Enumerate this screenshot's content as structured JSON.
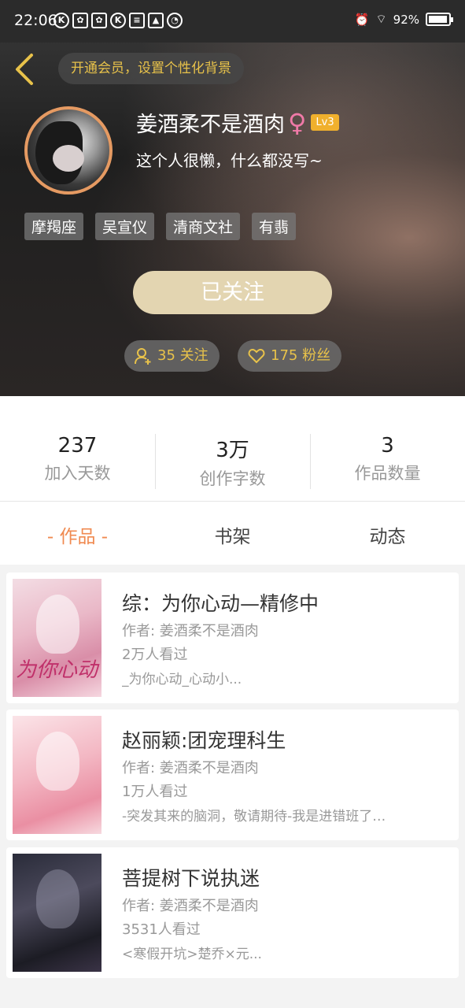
{
  "status": {
    "time": "22:06",
    "battery": "92%"
  },
  "header": {
    "vip_banner": "开通会员，设置个性化背景",
    "username": "姜酒柔不是酒肉",
    "gender": "♀",
    "level": "Lv3",
    "bio": "这个人很懒，什么都没写~",
    "tags": [
      "摩羯座",
      "吴宣仪",
      "清商文社",
      "有翡"
    ],
    "follow_label": "已关注",
    "following_text": "35 关注",
    "fans_text": "175 粉丝"
  },
  "stats": [
    {
      "value": "237",
      "label": "加入天数"
    },
    {
      "value": "3万",
      "label": "创作字数"
    },
    {
      "value": "3",
      "label": "作品数量"
    }
  ],
  "tabs": [
    "- 作品 -",
    "书架",
    "动态"
  ],
  "works": [
    {
      "title": "综：为你心动—精修中",
      "author": "作者: 姜酒柔不是酒肉",
      "views": "2万人看过",
      "desc": "_为你心动_心动小...",
      "cover_text": "为你心动"
    },
    {
      "title": "赵丽颖:团宠理科生",
      "author": "作者: 姜酒柔不是酒肉",
      "views": "1万人看过",
      "desc": "-突发其来的脑洞，敬请期待-我是进错班了…",
      "cover_text": ""
    },
    {
      "title": "菩提树下说执迷",
      "author": "作者: 姜酒柔不是酒肉",
      "views": "3531人看过",
      "desc": "<寒假开坑>楚乔×元...",
      "cover_text": ""
    }
  ],
  "colors": {
    "accent": "#f08a50",
    "gold": "#e8c24a",
    "follow_bg": "#e3d5b1",
    "level_bg": "#f0b02d"
  }
}
